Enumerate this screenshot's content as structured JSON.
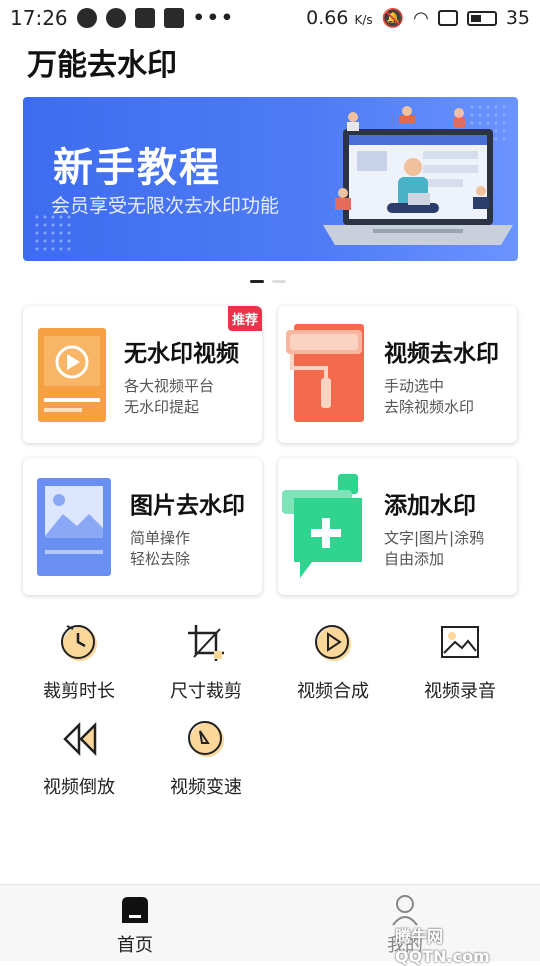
{
  "status_bar": {
    "time": "17:26",
    "speed": "0.66",
    "speed_unit": "K/s",
    "battery": "35",
    "more": "•••"
  },
  "app": {
    "title": "万能去水印"
  },
  "banner": {
    "title": "新手教程",
    "subtitle": "会员享受无限次去水印功能",
    "pager_active_index": 0,
    "pager_count": 2,
    "colors": {
      "bg_start": "#3e6cf0",
      "bg_end": "#6b94ff"
    }
  },
  "cards": [
    {
      "title": "无水印视频",
      "lines": [
        "各大视频平台",
        "无水印提起"
      ],
      "badge": "推荐",
      "icon": "video-play-icon",
      "color": "#f7a043"
    },
    {
      "title": "视频去水印",
      "lines": [
        "手动选中",
        "去除视频水印"
      ],
      "icon": "paint-roller-icon",
      "color": "#f46a4c"
    },
    {
      "title": "图片去水印",
      "lines": [
        "简单操作",
        "轻松去除"
      ],
      "icon": "image-icon",
      "color": "#5a82f0"
    },
    {
      "title": "添加水印",
      "lines": [
        "文字|图片|涂鸦",
        "自由添加"
      ],
      "icon": "add-watermark-icon",
      "color": "#2fd48f"
    }
  ],
  "tools": [
    {
      "label": "裁剪时长",
      "icon": "clock-icon"
    },
    {
      "label": "尺寸裁剪",
      "icon": "crop-icon"
    },
    {
      "label": "视频合成",
      "icon": "play-circle-icon"
    },
    {
      "label": "视频录音",
      "icon": "picture-icon"
    },
    {
      "label": "视频倒放",
      "icon": "rewind-icon"
    },
    {
      "label": "视频变速",
      "icon": "speed-dial-icon"
    }
  ],
  "bottom_nav": {
    "home_label": "首页",
    "mine_label": "我的"
  },
  "watermark": {
    "text": "腾牛网 QQTN.com"
  }
}
